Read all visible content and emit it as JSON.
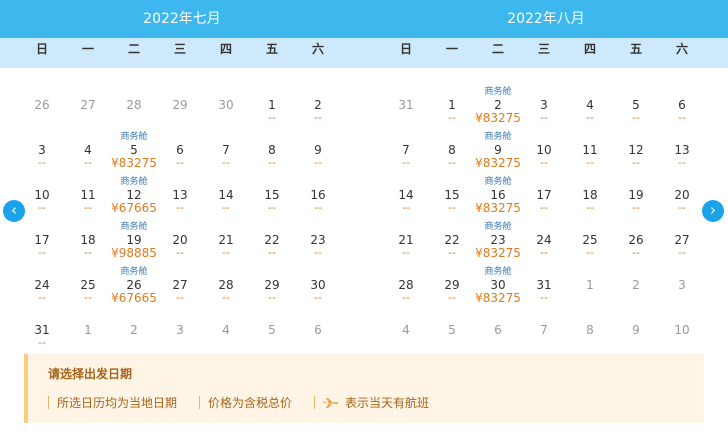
{
  "months": [
    {
      "title": "2022年七月",
      "weekdays": [
        "日",
        "一",
        "二",
        "三",
        "四",
        "五",
        "六"
      ],
      "rows": [
        [
          {
            "d": "26",
            "o": true
          },
          {
            "d": "27",
            "o": true
          },
          {
            "d": "28",
            "o": true
          },
          {
            "d": "29",
            "o": true
          },
          {
            "d": "30",
            "o": true
          },
          {
            "d": "1",
            "p": "--"
          },
          {
            "d": "2",
            "p": "--"
          }
        ],
        [
          {
            "d": "3",
            "p": "--"
          },
          {
            "d": "4",
            "p": "--"
          },
          {
            "d": "5",
            "t": "商务舱",
            "p": "¥83275"
          },
          {
            "d": "6",
            "p": "--"
          },
          {
            "d": "7",
            "p": "--"
          },
          {
            "d": "8",
            "p": "--"
          },
          {
            "d": "9",
            "p": "--"
          }
        ],
        [
          {
            "d": "10",
            "p": "--"
          },
          {
            "d": "11",
            "p": "--"
          },
          {
            "d": "12",
            "t": "商务舱",
            "p": "¥67665"
          },
          {
            "d": "13",
            "p": "--"
          },
          {
            "d": "14",
            "p": "--"
          },
          {
            "d": "15",
            "p": "--"
          },
          {
            "d": "16",
            "p": "--"
          }
        ],
        [
          {
            "d": "17",
            "p": "--"
          },
          {
            "d": "18",
            "p": "--"
          },
          {
            "d": "19",
            "t": "商务舱",
            "p": "¥98885"
          },
          {
            "d": "20",
            "p": "--"
          },
          {
            "d": "21",
            "p": "--"
          },
          {
            "d": "22",
            "p": "--"
          },
          {
            "d": "23",
            "p": "--"
          }
        ],
        [
          {
            "d": "24",
            "p": "--"
          },
          {
            "d": "25",
            "p": "--"
          },
          {
            "d": "26",
            "t": "商务舱",
            "p": "¥67665"
          },
          {
            "d": "27",
            "p": "--"
          },
          {
            "d": "28",
            "p": "--"
          },
          {
            "d": "29",
            "p": "--"
          },
          {
            "d": "30",
            "p": "--"
          }
        ],
        [
          {
            "d": "31",
            "p": "--"
          },
          {
            "d": "1",
            "o": true
          },
          {
            "d": "2",
            "o": true
          },
          {
            "d": "3",
            "o": true
          },
          {
            "d": "4",
            "o": true
          },
          {
            "d": "5",
            "o": true
          },
          {
            "d": "6",
            "o": true
          }
        ]
      ]
    },
    {
      "title": "2022年八月",
      "weekdays": [
        "日",
        "一",
        "二",
        "三",
        "四",
        "五",
        "六"
      ],
      "rows": [
        [
          {
            "d": "31",
            "o": true
          },
          {
            "d": "1",
            "p": "--"
          },
          {
            "d": "2",
            "t": "商务舱",
            "p": "¥83275"
          },
          {
            "d": "3",
            "p": "--"
          },
          {
            "d": "4",
            "p": "--"
          },
          {
            "d": "5",
            "p": "--"
          },
          {
            "d": "6",
            "p": "--"
          }
        ],
        [
          {
            "d": "7",
            "p": "--"
          },
          {
            "d": "8",
            "p": "--"
          },
          {
            "d": "9",
            "t": "商务舱",
            "p": "¥83275"
          },
          {
            "d": "10",
            "p": "--"
          },
          {
            "d": "11",
            "p": "--"
          },
          {
            "d": "12",
            "p": "--"
          },
          {
            "d": "13",
            "p": "--"
          }
        ],
        [
          {
            "d": "14",
            "p": "--"
          },
          {
            "d": "15",
            "p": "--"
          },
          {
            "d": "16",
            "t": "商务舱",
            "p": "¥83275"
          },
          {
            "d": "17",
            "p": "--"
          },
          {
            "d": "18",
            "p": "--"
          },
          {
            "d": "19",
            "p": "--"
          },
          {
            "d": "20",
            "p": "--"
          }
        ],
        [
          {
            "d": "21",
            "p": "--"
          },
          {
            "d": "22",
            "p": "--"
          },
          {
            "d": "23",
            "t": "商务舱",
            "p": "¥83275"
          },
          {
            "d": "24",
            "p": "--"
          },
          {
            "d": "25",
            "p": "--"
          },
          {
            "d": "26",
            "p": "--"
          },
          {
            "d": "27",
            "p": "--"
          }
        ],
        [
          {
            "d": "28",
            "p": "--"
          },
          {
            "d": "29",
            "p": "--"
          },
          {
            "d": "30",
            "t": "商务舱",
            "p": "¥83275"
          },
          {
            "d": "31",
            "p": "--"
          },
          {
            "d": "1",
            "o": true
          },
          {
            "d": "2",
            "o": true
          },
          {
            "d": "3",
            "o": true
          }
        ],
        [
          {
            "d": "4",
            "o": true
          },
          {
            "d": "5",
            "o": true
          },
          {
            "d": "6",
            "o": true
          },
          {
            "d": "7",
            "o": true
          },
          {
            "d": "8",
            "o": true
          },
          {
            "d": "9",
            "o": true
          },
          {
            "d": "10",
            "o": true
          }
        ]
      ]
    }
  ],
  "nav": {
    "prev_icon": "‹",
    "next_icon": "›",
    "prev_name": "chevron-left-icon",
    "next_name": "chevron-right-icon"
  },
  "legend": {
    "title": "请选择出发日期",
    "item1": "所选日历均为当地日期",
    "item2": "价格为含税总价",
    "item3": "表示当天有航班",
    "plane_icon": "plane-icon"
  },
  "colors": {
    "header": "#3db8ef",
    "weekday_bg": "#cde9fb",
    "price": "#e07a1a",
    "tag": "#3a79b8",
    "legend_bg": "#fff5e6"
  }
}
